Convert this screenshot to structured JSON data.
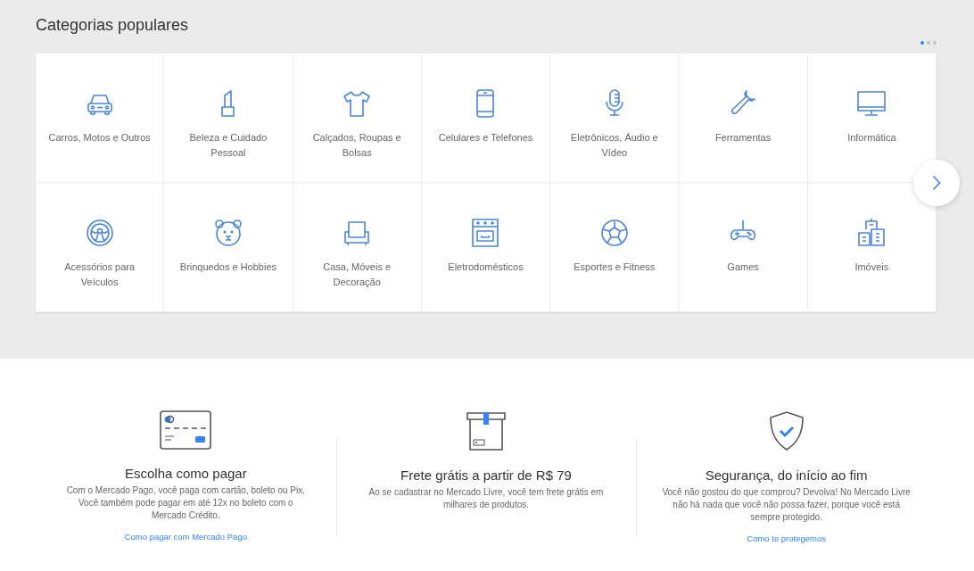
{
  "categories_section": {
    "title": "Categorias populares",
    "pager": [
      {
        "selected": true
      },
      {
        "selected": false
      },
      {
        "selected": false
      }
    ],
    "items": [
      {
        "label": "Carros, Motos e Outros"
      },
      {
        "label": "Beleza e Cuidado Pessoal"
      },
      {
        "label": "Calçados, Roupas e Bolsas"
      },
      {
        "label": "Celulares e Telefones"
      },
      {
        "label": "Eletrônicos, Áudio e Vídeo"
      },
      {
        "label": "Ferramentas"
      },
      {
        "label": "Informática"
      },
      {
        "label": "Acessórios para Veículos"
      },
      {
        "label": "Brinquedos e Hobbies"
      },
      {
        "label": "Casa, Móveis e Decoração"
      },
      {
        "label": "Eletrodomésticos"
      },
      {
        "label": "Esportes e Fitness"
      },
      {
        "label": "Games"
      },
      {
        "label": "Imóveis"
      }
    ]
  },
  "features": [
    {
      "title": "Escolha como pagar",
      "text": "Com o Mercado Pago, você paga com cartão, boleto ou Pix. Você também pode pagar em até 12x no boleto com o Mercado Crédito.",
      "link": "Como pagar com Mercado Pago"
    },
    {
      "title": "Frete grátis a partir de R$ 79",
      "text": "Ao se cadastrar no Mercado Livre, você tem frete grátis em milhares de produtos."
    },
    {
      "title": "Segurança, do início ao fim",
      "text": "Você não gostou do que comprou? Devolva! No Mercado Livre não há nada que você não possa fazer, porque você está sempre protegido.",
      "link": "Como te protegemos"
    }
  ]
}
